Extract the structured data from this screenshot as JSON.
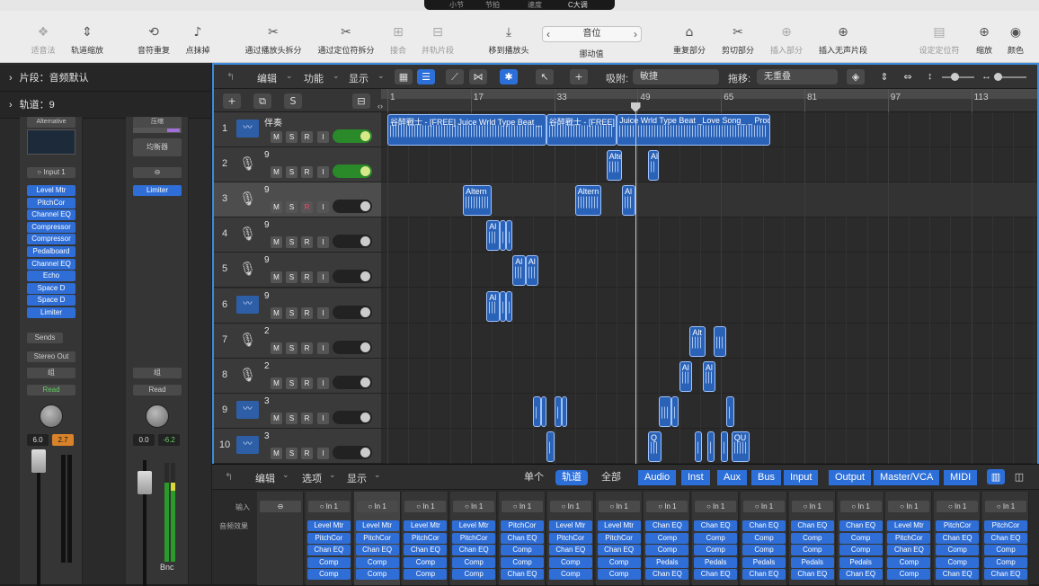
{
  "lcd": {
    "bar_label": "小节",
    "beat_label": "节拍",
    "tempo_label": "速度",
    "key": "C大调"
  },
  "toolbar": {
    "items": [
      {
        "label": "适音法",
        "icon": "❖",
        "dim": true
      },
      {
        "label": "轨道缩放",
        "icon": "⇕",
        "dim": false
      },
      {
        "label": "音符重复",
        "icon": "⟲",
        "dim": false
      },
      {
        "label": "点抹掉",
        "icon": "♪",
        "dim": false
      },
      {
        "label": "通过播放头拆分",
        "icon": "✂",
        "dim": false
      },
      {
        "label": "通过定位符拆分",
        "icon": "✂",
        "dim": false
      },
      {
        "label": "接合",
        "icon": "⊞",
        "dim": true
      },
      {
        "label": "并轨片段",
        "icon": "⊟",
        "dim": true
      },
      {
        "label": "移到播放头",
        "icon": "⤓",
        "dim": false
      },
      {
        "label": "挪动值",
        "icon": "",
        "dim": false
      },
      {
        "label": "重复部分",
        "icon": "⌂",
        "dim": false
      },
      {
        "label": "剪切部分",
        "icon": "✂",
        "dim": false
      },
      {
        "label": "插入部分",
        "icon": "⊕",
        "dim": true
      },
      {
        "label": "插入无声片段",
        "icon": "⊕",
        "dim": false
      },
      {
        "label": "设定定位符",
        "icon": "▤",
        "dim": true
      },
      {
        "label": "缩放",
        "icon": "⊕",
        "dim": false
      },
      {
        "label": "颜色",
        "icon": "◉",
        "dim": false
      }
    ],
    "position_value": "音位"
  },
  "inspector": {
    "region_label": "片段：",
    "region_value": "音频默认",
    "track_label": "轨道：",
    "track_value": "9",
    "strip1": {
      "setting": "Alternative",
      "input": "Input 1",
      "plugins": [
        "Level Mtr",
        "PitchCor",
        "Channel EQ",
        "Compressor",
        "Compressor",
        "Pedalboard",
        "Channel EQ",
        "Echo",
        "Space D",
        "Space D",
        "Limiter"
      ],
      "sends": "Sends",
      "output": "Stereo Out",
      "group": "组",
      "automation": "Read",
      "volume": "6.0",
      "peak": "2.7"
    },
    "strip2": {
      "setting": "压缩",
      "eq_label": "均衡器",
      "plugins": [
        "Limiter"
      ],
      "group": "组",
      "automation": "Read",
      "volume": "0.0",
      "peak": "-6.2",
      "bottom": "Bnc"
    }
  },
  "editor": {
    "menus": [
      "编辑",
      "功能",
      "显示"
    ],
    "snap_label": "吸附:",
    "snap_value": "敏捷",
    "drag_label": "拖移:",
    "drag_value": "无重叠"
  },
  "ruler": {
    "bars": [
      "1",
      "17",
      "33",
      "49",
      "65",
      "81",
      "97",
      "113"
    ]
  },
  "tracks": [
    {
      "num": "1",
      "name": "伴奏",
      "type": "wave",
      "rec": false,
      "on": true
    },
    {
      "num": "2",
      "name": "9",
      "type": "mic",
      "rec": false,
      "on": true
    },
    {
      "num": "3",
      "name": "9",
      "type": "mic",
      "rec": true,
      "on": false
    },
    {
      "num": "4",
      "name": "9",
      "type": "mic",
      "rec": false,
      "on": false
    },
    {
      "num": "5",
      "name": "9",
      "type": "mic",
      "rec": false,
      "on": false
    },
    {
      "num": "6",
      "name": "9",
      "type": "wave",
      "rec": false,
      "on": false
    },
    {
      "num": "7",
      "name": "2",
      "type": "mic",
      "rec": false,
      "on": false
    },
    {
      "num": "8",
      "name": "2",
      "type": "mic",
      "rec": false,
      "on": false
    },
    {
      "num": "9",
      "name": "3",
      "type": "wave",
      "rec": false,
      "on": false
    },
    {
      "num": "10",
      "name": "3",
      "type": "wave",
      "rec": false,
      "on": false
    }
  ],
  "track_buttons": {
    "m": "M",
    "s": "S",
    "r": "R",
    "i": "I"
  },
  "regions": [
    {
      "lane": 0,
      "start": 1,
      "end": 31.5,
      "label": "谷醉戰士 - [FREE] Juice Wrld Type Beat _"
    },
    {
      "lane": 0,
      "start": 31.5,
      "end": 45,
      "label": "谷醉戰士 - [FREE]"
    },
    {
      "lane": 0,
      "start": 45,
      "end": 74.5,
      "label": "Juice Wrld Type Beat _Love Song_ _ Prod."
    },
    {
      "lane": 1,
      "start": 43,
      "end": 46,
      "label": "Alte"
    },
    {
      "lane": 1,
      "start": 51,
      "end": 53,
      "label": "Al"
    },
    {
      "lane": 2,
      "start": 15.5,
      "end": 21,
      "label": "Altern"
    },
    {
      "lane": 2,
      "start": 37,
      "end": 42,
      "label": "Altern"
    },
    {
      "lane": 2,
      "start": 46,
      "end": 48.5,
      "label": "Al"
    },
    {
      "lane": 3,
      "start": 20,
      "end": 22.5,
      "label": "Al"
    },
    {
      "lane": 3,
      "start": 22.5,
      "end": 23.8,
      "label": ""
    },
    {
      "lane": 3,
      "start": 23.8,
      "end": 25,
      "label": ""
    },
    {
      "lane": 4,
      "start": 25,
      "end": 27.5,
      "label": "Al"
    },
    {
      "lane": 4,
      "start": 27.5,
      "end": 30,
      "label": "Al"
    },
    {
      "lane": 5,
      "start": 20,
      "end": 22.5,
      "label": "Al"
    },
    {
      "lane": 5,
      "start": 22.5,
      "end": 23.8,
      "label": ""
    },
    {
      "lane": 5,
      "start": 23.8,
      "end": 25,
      "label": ""
    },
    {
      "lane": 6,
      "start": 59,
      "end": 62,
      "label": "Alt"
    },
    {
      "lane": 6,
      "start": 63.5,
      "end": 66,
      "label": ""
    },
    {
      "lane": 7,
      "start": 57,
      "end": 59.5,
      "label": "Al"
    },
    {
      "lane": 7,
      "start": 61.5,
      "end": 64,
      "label": "Al"
    },
    {
      "lane": 8,
      "start": 29,
      "end": 30.5,
      "label": ""
    },
    {
      "lane": 8,
      "start": 30.5,
      "end": 31.5,
      "label": ""
    },
    {
      "lane": 8,
      "start": 33,
      "end": 34.5,
      "label": ""
    },
    {
      "lane": 8,
      "start": 34.5,
      "end": 35.5,
      "label": ""
    },
    {
      "lane": 8,
      "start": 53,
      "end": 55.5,
      "label": ""
    },
    {
      "lane": 8,
      "start": 55.5,
      "end": 56.8,
      "label": ""
    },
    {
      "lane": 8,
      "start": 66,
      "end": 67.5,
      "label": ""
    },
    {
      "lane": 9,
      "start": 31.5,
      "end": 33,
      "label": ""
    },
    {
      "lane": 9,
      "start": 51,
      "end": 53.5,
      "label": "Q"
    },
    {
      "lane": 9,
      "start": 60,
      "end": 61.3,
      "label": ""
    },
    {
      "lane": 9,
      "start": 62.3,
      "end": 63.8,
      "label": ""
    },
    {
      "lane": 9,
      "start": 65,
      "end": 66.3,
      "label": ""
    },
    {
      "lane": 9,
      "start": 67,
      "end": 70.5,
      "label": "QU"
    }
  ],
  "playhead_bar": 48.5,
  "mixer": {
    "menus": [
      "编辑",
      "选项",
      "显示"
    ],
    "view_tabs": [
      "单个",
      "轨道",
      "全部"
    ],
    "types": [
      "Audio",
      "Inst",
      "Aux",
      "Bus",
      "Input",
      "Output",
      "Master/VCA",
      "MIDI"
    ],
    "input_label": "输入",
    "fx_label": "音频效果",
    "channels": [
      {
        "input": "",
        "plugins": []
      },
      {
        "input": "In 1",
        "plugins": [
          "Level Mtr",
          "PitchCor",
          "Chan EQ",
          "Comp",
          "Comp"
        ]
      },
      {
        "input": "In 1",
        "plugins": [
          "Level Mtr",
          "PitchCor",
          "Chan EQ",
          "Comp",
          "Comp"
        ]
      },
      {
        "input": "In 1",
        "plugins": [
          "Level Mtr",
          "PitchCor",
          "Chan EQ",
          "Comp",
          "Comp"
        ]
      },
      {
        "input": "In 1",
        "plugins": [
          "Level Mtr",
          "PitchCor",
          "Chan EQ",
          "Comp",
          "Comp"
        ]
      },
      {
        "input": "In 1",
        "plugins": [
          "PitchCor",
          "Chan EQ",
          "Comp",
          "Comp",
          "Chan EQ"
        ]
      },
      {
        "input": "In 1",
        "plugins": [
          "Level Mtr",
          "PitchCor",
          "Chan EQ",
          "Comp",
          "Comp"
        ]
      },
      {
        "input": "In 1",
        "plugins": [
          "Level Mtr",
          "PitchCor",
          "Chan EQ",
          "Comp",
          "Comp"
        ]
      },
      {
        "input": "In 1",
        "plugins": [
          "Chan EQ",
          "Comp",
          "Comp",
          "Pedals",
          "Chan EQ"
        ]
      },
      {
        "input": "In 1",
        "plugins": [
          "Chan EQ",
          "Comp",
          "Comp",
          "Pedals",
          "Chan EQ"
        ]
      },
      {
        "input": "In 1",
        "plugins": [
          "Chan EQ",
          "Comp",
          "Comp",
          "Pedals",
          "Chan EQ"
        ]
      },
      {
        "input": "In 1",
        "plugins": [
          "Chan EQ",
          "Comp",
          "Comp",
          "Pedals",
          "Chan EQ"
        ]
      },
      {
        "input": "In 1",
        "plugins": [
          "Chan EQ",
          "Comp",
          "Comp",
          "Pedals",
          "Chan EQ"
        ]
      },
      {
        "input": "In 1",
        "plugins": [
          "Level Mtr",
          "PitchCor",
          "Chan EQ",
          "Comp",
          "Comp"
        ]
      },
      {
        "input": "In 1",
        "plugins": [
          "PitchCor",
          "Chan EQ",
          "Comp",
          "Comp",
          "Chan EQ"
        ]
      },
      {
        "input": "In 1",
        "plugins": [
          "PitchCor",
          "Chan EQ",
          "Comp",
          "Comp",
          "Chan EQ"
        ]
      }
    ]
  }
}
